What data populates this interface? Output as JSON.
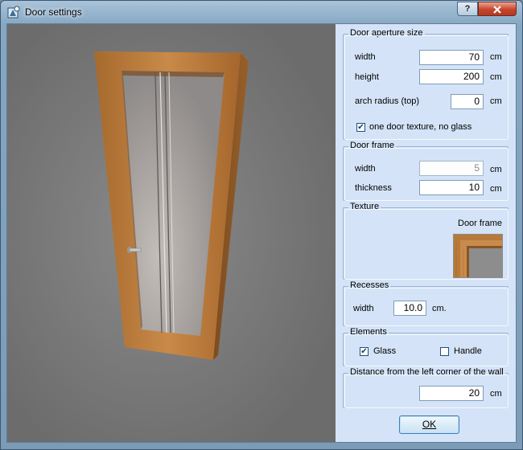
{
  "window": {
    "title": "Door settings",
    "help_label": "?",
    "close_label": "x"
  },
  "aperture": {
    "legend": "Door aperture size",
    "width_label": "width",
    "width_value": "70",
    "width_unit": "cm",
    "height_label": "height",
    "height_value": "200",
    "height_unit": "cm",
    "arch_label": "arch radius (top)",
    "arch_value": "0",
    "arch_unit": "cm",
    "one_texture_label": "one door texture, no glass",
    "one_texture_checked": true
  },
  "frame": {
    "legend": "Door frame",
    "width_label": "width",
    "width_value": "5",
    "width_unit": "cm",
    "thickness_label": "thickness",
    "thickness_value": "10",
    "thickness_unit": "cm"
  },
  "texture": {
    "legend": "Texture",
    "door_frame_label": "Door frame"
  },
  "recesses": {
    "legend": "Recesses",
    "width_label": "width",
    "width_value": "10.0",
    "width_unit": "cm."
  },
  "elements": {
    "legend": "Elements",
    "glass_label": "Glass",
    "glass_checked": true,
    "handle_label": "Handle",
    "handle_checked": false
  },
  "distance": {
    "legend": "Distance from the left corner of the wall",
    "value": "20",
    "unit": "cm"
  },
  "ok_label": "OK",
  "colors": {
    "wood": "#b97a3c",
    "glass": "#9a9594",
    "preview_bg": "#787878",
    "panel_bg": "#d4e3f7"
  }
}
